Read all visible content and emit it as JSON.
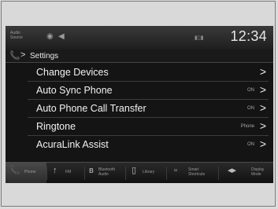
{
  "status_bar": {
    "audio_source_line1": "Audio",
    "audio_source_line2": "Source",
    "time": "12:34"
  },
  "breadcrumb": {
    "text": "Settings"
  },
  "settings_list": [
    {
      "label": "Change Devices",
      "value": ""
    },
    {
      "label": "Auto Sync Phone",
      "value": "ON"
    },
    {
      "label": "Auto Phone Call Transfer",
      "value": "ON"
    },
    {
      "label": "Ringtone",
      "value": "Phone"
    },
    {
      "label": "AcuraLink Assist",
      "value": "ON"
    }
  ],
  "bottom_nav": {
    "phone": "Phone",
    "fm": "FM",
    "bluetooth_line1": "Bluetooth",
    "bluetooth_line2": "Audio",
    "library": "Library",
    "smart_line1": "Smart",
    "smart_line2": "Shortcuts",
    "display_line1": "Display",
    "display_line2": "Mode"
  }
}
